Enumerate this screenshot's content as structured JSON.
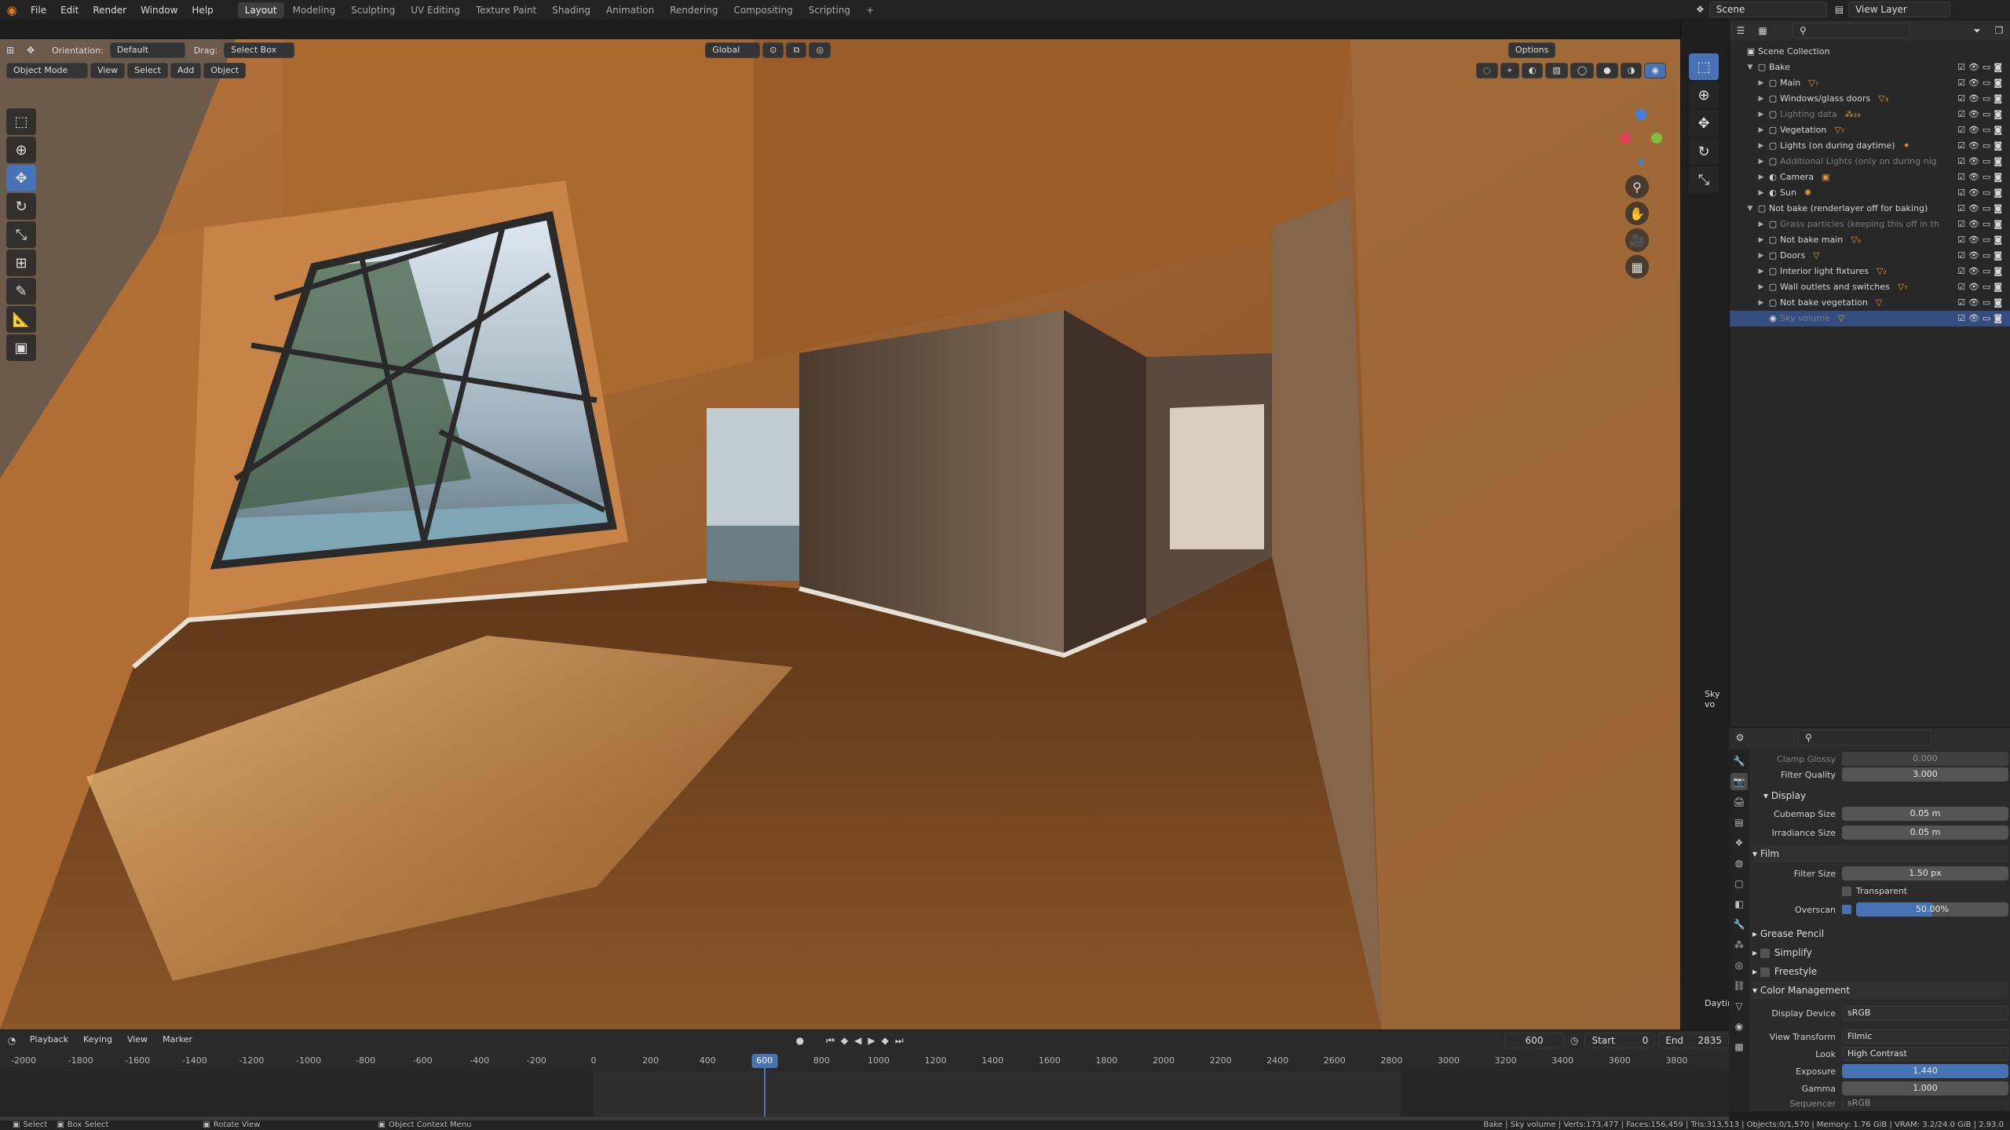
{
  "menu": [
    "File",
    "Edit",
    "Render",
    "Window",
    "Help"
  ],
  "workspaces": [
    "Layout",
    "Modeling",
    "Sculpting",
    "UV Editing",
    "Texture Paint",
    "Shading",
    "Animation",
    "Rendering",
    "Compositing",
    "Scripting"
  ],
  "active_workspace": "Layout",
  "add_workspace": "+",
  "scene_field": "Scene",
  "view_layer_field": "View Layer",
  "viewport_header": {
    "orientation_label": "Orientation:",
    "orientation_value": "Default",
    "drag_label": "Drag:",
    "drag_value": "Select Box",
    "transform_orientation": "Global",
    "options": "Options"
  },
  "viewport_header2": {
    "mode": "Object Mode",
    "view": "View",
    "select": "Select",
    "add": "Add",
    "object": "Object"
  },
  "viewport_side_label_1": "Sky vo",
  "viewport_side_label_2": "Daytir",
  "outliner": {
    "rows": [
      {
        "label": "Scene Collection",
        "depth": 0,
        "arrow": "",
        "icon": "▣",
        "dim": false,
        "badge": ""
      },
      {
        "label": "Bake",
        "depth": 1,
        "arrow": "▼",
        "icon": "▢",
        "dim": false,
        "badge": ""
      },
      {
        "label": "Main",
        "depth": 2,
        "arrow": "▶",
        "icon": "▢",
        "dim": false,
        "badge": "▽₇"
      },
      {
        "label": "Windows/glass doors",
        "depth": 2,
        "arrow": "▶",
        "icon": "▢",
        "dim": false,
        "badge": "▽₃"
      },
      {
        "label": "Lighting data",
        "depth": 2,
        "arrow": "▶",
        "icon": "▢",
        "dim": true,
        "badge": "⁂₂₉"
      },
      {
        "label": "Vegetation",
        "depth": 2,
        "arrow": "▶",
        "icon": "▢",
        "dim": false,
        "badge": "▽₇"
      },
      {
        "label": "Lights (on during daytime)",
        "depth": 2,
        "arrow": "▶",
        "icon": "▢",
        "dim": false,
        "badge": "✦"
      },
      {
        "label": "Additional Lights (only on during nig",
        "depth": 2,
        "arrow": "▶",
        "icon": "▢",
        "dim": true,
        "badge": ""
      },
      {
        "label": "Camera",
        "depth": 2,
        "arrow": "▶",
        "icon": "◐",
        "dim": false,
        "badge": "▣"
      },
      {
        "label": "Sun",
        "depth": 2,
        "arrow": "▶",
        "icon": "◐",
        "dim": false,
        "badge": "✺"
      },
      {
        "label": "Not bake (renderlayer off for baking)",
        "depth": 1,
        "arrow": "▼",
        "icon": "▢",
        "dim": false,
        "badge": ""
      },
      {
        "label": "Grass particles (keeping this off in th",
        "depth": 2,
        "arrow": "▶",
        "icon": "▢",
        "dim": true,
        "badge": ""
      },
      {
        "label": "Not bake main",
        "depth": 2,
        "arrow": "▶",
        "icon": "▢",
        "dim": false,
        "badge": "▽₅"
      },
      {
        "label": "Doors",
        "depth": 2,
        "arrow": "▶",
        "icon": "▢",
        "dim": false,
        "badge": "▽"
      },
      {
        "label": "Interior light fixtures",
        "depth": 2,
        "arrow": "▶",
        "icon": "▢",
        "dim": false,
        "badge": "▽₂"
      },
      {
        "label": "Wall outlets and switches",
        "depth": 2,
        "arrow": "▶",
        "icon": "▢",
        "dim": false,
        "badge": "▽₇"
      },
      {
        "label": "Not bake vegetation",
        "depth": 2,
        "arrow": "▶",
        "icon": "▢",
        "dim": false,
        "badge": "▽"
      },
      {
        "label": "Sky volume",
        "depth": 2,
        "arrow": "",
        "icon": "◉",
        "dim": true,
        "badge": "▽"
      }
    ]
  },
  "properties": {
    "clamp_glossy_label": "Clamp Glossy",
    "clamp_glossy_value": "0.000",
    "filter_quality_label": "Filter Quality",
    "filter_quality_value": "3.000",
    "display_section": "Display",
    "cubemap_label": "Cubemap Size",
    "cubemap_value": "0.05 m",
    "irradiance_label": "Irradiance Size",
    "irradiance_value": "0.05 m",
    "film_section": "Film",
    "filter_size_label": "Filter Size",
    "filter_size_value": "1.50 px",
    "transparent_label": "Transparent",
    "overscan_label": "Overscan",
    "overscan_value": "50.00%",
    "overscan_fraction": 0.5,
    "grease_pencil_section": "Grease Pencil",
    "simplify_section": "Simplify",
    "freestyle_section": "Freestyle",
    "color_mgmt_section": "Color Management",
    "display_device_label": "Display Device",
    "display_device_value": "sRGB",
    "view_transform_label": "View Transform",
    "view_transform_value": "Filmic",
    "look_label": "Look",
    "look_value": "High Contrast",
    "exposure_label": "Exposure",
    "exposure_value": "1.440",
    "gamma_label": "Gamma",
    "gamma_value": "1.000",
    "sequencer_label": "Sequencer",
    "sequencer_value": "sRGB"
  },
  "timeline": {
    "playback": "Playback",
    "keying": "Keying",
    "view": "View",
    "marker": "Marker",
    "current_frame": "600",
    "start_label": "Start",
    "start_value": "0",
    "end_label": "End",
    "end_value": "2835",
    "ruler": [
      "-2000",
      "-1800",
      "-1600",
      "-1400",
      "-1200",
      "-1000",
      "-800",
      "-600",
      "-400",
      "-200",
      "0",
      "200",
      "400",
      "600",
      "800",
      "1000",
      "1200",
      "1400",
      "1600",
      "1800",
      "2000",
      "2200",
      "2400",
      "2600",
      "2800",
      "3000",
      "3200",
      "3400",
      "3600",
      "3800"
    ],
    "playhead": "600"
  },
  "status": {
    "select": "Select",
    "box_select": "Box Select",
    "rotate_view": "Rotate View",
    "context_menu": "Object Context Menu",
    "stats": "Bake | Sky volume | Verts:173,477 | Faces:156,459 | Tris:313,513 | Objects:0/1,570 | Memory: 1.76 GiB | VRAM: 3.2/24.0 GiB | 2.93.0"
  },
  "colors": {
    "accent": "#4772b3",
    "bg": "#1d1d1d",
    "panel": "#2b2b2b",
    "wood": "#8a5528"
  }
}
